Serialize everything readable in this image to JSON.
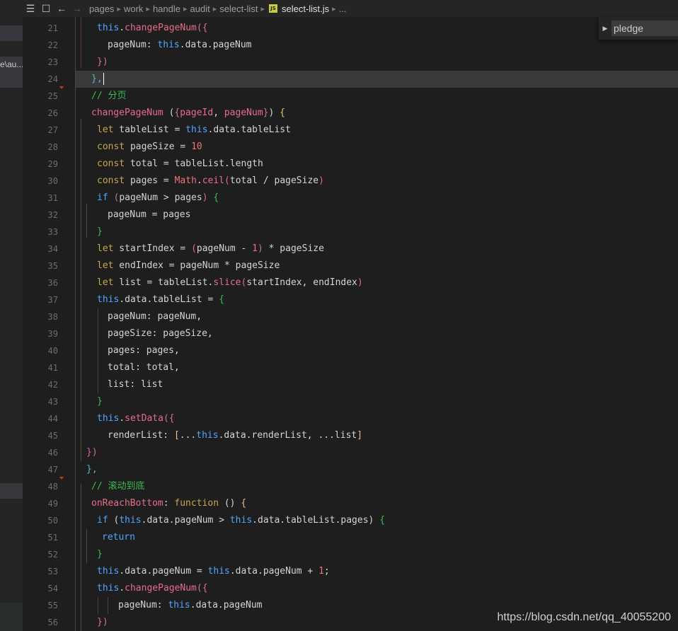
{
  "sidebar": {
    "truncated_path": "e\\au..."
  },
  "breadcrumb": {
    "items": [
      "pages",
      "work",
      "handle",
      "audit",
      "select-list"
    ],
    "file_badge": "JS",
    "file": "select-list.js",
    "ellipsis": "..."
  },
  "find": {
    "query": "pledge"
  },
  "line_numbers": [
    "21",
    "22",
    "23",
    "24",
    "25",
    "26",
    "27",
    "28",
    "29",
    "30",
    "31",
    "32",
    "33",
    "34",
    "35",
    "36",
    "37",
    "38",
    "39",
    "40",
    "41",
    "42",
    "43",
    "44",
    "45",
    "46",
    "47",
    "48",
    "49",
    "50",
    "51",
    "52",
    "53",
    "54",
    "55",
    "56"
  ],
  "code": {
    "l21": [
      "this",
      ".",
      "changePageNum",
      "({"
    ],
    "l22": [
      "pageNum",
      ": ",
      "this",
      ".data.pageNum"
    ],
    "l23": [
      "})"
    ],
    "l24": [
      "},"
    ],
    "l25": [
      "// 分页"
    ],
    "l26": [
      "changePageNum",
      " (",
      "{",
      "pageId",
      ", ",
      "pageNum",
      "}",
      ") ",
      "{"
    ],
    "l27": [
      "let",
      " tableList = ",
      "this",
      ".data.tableList"
    ],
    "l28": [
      "const",
      " pageSize = ",
      "10"
    ],
    "l29": [
      "const",
      " total = tableList.length"
    ],
    "l30": [
      "const",
      " pages = ",
      "Math",
      ".",
      "ceil",
      "(",
      "total / pageSize",
      ")"
    ],
    "l31": [
      "if",
      " (",
      "pageNum > pages",
      ") ",
      "{"
    ],
    "l32": [
      "pageNum = pages"
    ],
    "l33": [
      "}"
    ],
    "l34": [
      "let",
      " startIndex = ",
      "(",
      "pageNum - ",
      "1",
      ")",
      " * pageSize"
    ],
    "l35": [
      "let",
      " endIndex = pageNum * pageSize"
    ],
    "l36": [
      "let",
      " list = tableList.",
      "slice",
      "(",
      "startIndex, endIndex",
      ")"
    ],
    "l37": [
      "this",
      ".data.tableList = ",
      "{"
    ],
    "l38": [
      "pageNum",
      ": pageNum,"
    ],
    "l39": [
      "pageSize",
      ": pageSize,"
    ],
    "l40": [
      "pages",
      ": pages,"
    ],
    "l41": [
      "total",
      ": total,"
    ],
    "l42": [
      "list",
      ": list"
    ],
    "l43": [
      "}"
    ],
    "l44": [
      "this",
      ".",
      "setData",
      "({"
    ],
    "l45": [
      "renderList",
      ": ",
      "[",
      "...",
      "this",
      ".data.renderList, ...list",
      "]"
    ],
    "l46": [
      "})"
    ],
    "l47": [
      "},"
    ],
    "l48": [
      "// 滚动到底"
    ],
    "l49": [
      "onReachBottom",
      ": ",
      "function",
      " () ",
      "{"
    ],
    "l50": [
      "if",
      " (",
      "this",
      ".data.pageNum > ",
      "this",
      ".data.tableList.pages",
      ") ",
      "{"
    ],
    "l51": [
      "return"
    ],
    "l52": [
      "}"
    ],
    "l53": [
      "this",
      ".data.pageNum = ",
      "this",
      ".data.pageNum + ",
      "1",
      ";"
    ],
    "l54": [
      "this",
      ".",
      "changePageNum",
      "({"
    ],
    "l55": [
      "pageNum",
      ": ",
      "this",
      ".data.pageNum"
    ],
    "l56": [
      "})"
    ]
  },
  "watermark": "https://blog.csdn.net/qq_40055200"
}
